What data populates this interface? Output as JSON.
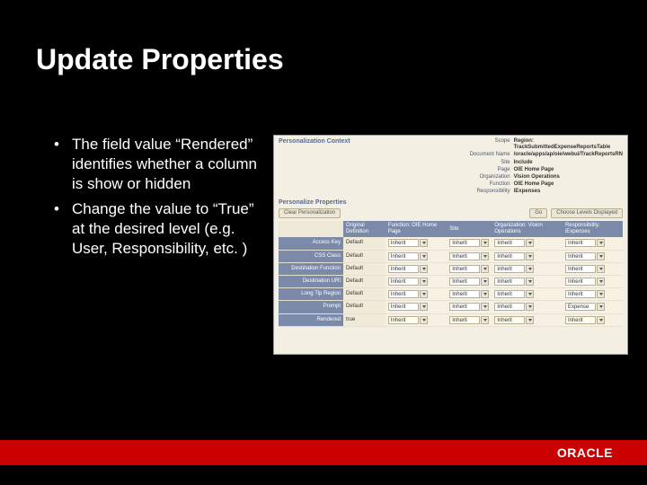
{
  "title": "Update Properties",
  "bullets": [
    "The field value “Rendered” identifies whether a column is show or hidden",
    "Change the value to “True” at the desired level (e.g. User, Responsibility, etc. )"
  ],
  "screenshot": {
    "context_heading": "Personalization Context",
    "context": [
      {
        "label": "Scope",
        "value": "Region: TrackSubmittedExpenseReportsTable"
      },
      {
        "label": "Document Name",
        "value": "/oracle/apps/ap/oie/webui/TrackReportsRN"
      },
      {
        "label": "Site",
        "value": "Include"
      },
      {
        "label": "Page",
        "value": "OIE Home Page"
      },
      {
        "label": "Organization",
        "value": "Vision Operations"
      },
      {
        "label": "Function",
        "value": "OIE Home Page"
      },
      {
        "label": "Responsibility",
        "value": "iExpenses"
      }
    ],
    "sub_heading": "Personalize Properties",
    "buttons": {
      "clear": "Clear Personalization",
      "go": "Go",
      "choose_levels": "Choose Levels Displayed"
    },
    "columns": [
      "",
      "Original Definition",
      "Function: OIE Home Page",
      "Site",
      "Organization: Vision Operations",
      "Responsibility: iExpenses"
    ],
    "rows": [
      {
        "name": "Access Key",
        "orig": "Default",
        "vals": [
          "Inherit",
          "Inherit",
          "Inherit",
          "Inherit"
        ]
      },
      {
        "name": "CSS Class",
        "orig": "Default",
        "vals": [
          "Inherit",
          "Inherit",
          "Inherit",
          "Inherit"
        ]
      },
      {
        "name": "Destination Function",
        "orig": "Default",
        "vals": [
          "Inherit",
          "Inherit",
          "Inherit",
          "Inherit"
        ]
      },
      {
        "name": "Destination URI",
        "orig": "Default",
        "vals": [
          "Inherit",
          "Inherit",
          "Inherit",
          "Inherit"
        ]
      },
      {
        "name": "Long Tip Region",
        "orig": "Default",
        "vals": [
          "Inherit",
          "Inherit",
          "Inherit",
          "Inherit"
        ]
      },
      {
        "name": "Prompt",
        "orig": "Default",
        "vals": [
          "Inherit",
          "Inherit",
          "Inherit",
          "Expense Reports"
        ]
      },
      {
        "name": "Rendered",
        "orig": "true",
        "vals": [
          "Inherit",
          "Inherit",
          "Inherit",
          "Inherit"
        ]
      }
    ]
  },
  "logo": "ORACLE"
}
